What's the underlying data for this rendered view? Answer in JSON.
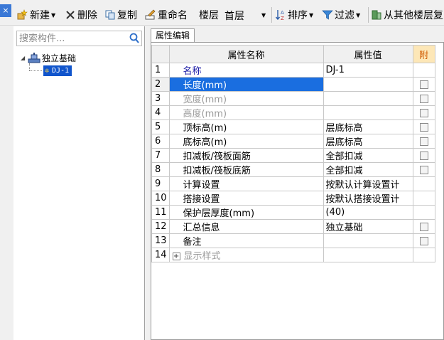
{
  "toolbar": {
    "close_glyph": "×",
    "new_label": "新建",
    "delete_label": "删除",
    "copy_label": "复制",
    "rename_label": "重命名",
    "floor_label": "楼层",
    "floor_value": "首层",
    "sort_label": "排序",
    "filter_label": "过滤",
    "copy_from_floor_label": "从其他楼层复"
  },
  "left_panel": {
    "search_placeholder": "搜索构件...",
    "tree": {
      "root_label": "独立基础",
      "child_label": "DJ-1"
    }
  },
  "main": {
    "tab_label": "属性编辑",
    "headers": {
      "name": "属性名称",
      "value": "属性值",
      "attach": "附"
    },
    "rows": [
      {
        "num": "1",
        "name": "名称",
        "value": "DJ-1",
        "style": "blue",
        "checkbox": false
      },
      {
        "num": "2",
        "name": "长度(mm)",
        "value": "",
        "style": "selected",
        "checkbox": true
      },
      {
        "num": "3",
        "name": "宽度(mm)",
        "value": "",
        "style": "gray",
        "checkbox": true
      },
      {
        "num": "4",
        "name": "高度(mm)",
        "value": "",
        "style": "gray",
        "checkbox": true
      },
      {
        "num": "5",
        "name": "顶标高(m)",
        "value": "层底标高",
        "style": "normal",
        "checkbox": true
      },
      {
        "num": "6",
        "name": "底标高(m)",
        "value": "层底标高",
        "style": "normal",
        "checkbox": true
      },
      {
        "num": "7",
        "name": "扣减板/筏板面筋",
        "value": "全部扣减",
        "style": "normal",
        "checkbox": true
      },
      {
        "num": "8",
        "name": "扣减板/筏板底筋",
        "value": "全部扣减",
        "style": "normal",
        "checkbox": true
      },
      {
        "num": "9",
        "name": "计算设置",
        "value": "按默认计算设置计",
        "style": "normal",
        "checkbox": false
      },
      {
        "num": "10",
        "name": "搭接设置",
        "value": "按默认搭接设置计",
        "style": "normal",
        "checkbox": false
      },
      {
        "num": "11",
        "name": "保护层厚度(mm)",
        "value": "(40)",
        "style": "normal",
        "checkbox": false
      },
      {
        "num": "12",
        "name": "汇总信息",
        "value": "独立基础",
        "style": "normal",
        "checkbox": true
      },
      {
        "num": "13",
        "name": "备注",
        "value": "",
        "style": "normal",
        "checkbox": true
      },
      {
        "num": "14",
        "name": "显示样式",
        "value": "",
        "style": "gray-expand",
        "checkbox": false
      }
    ]
  },
  "colors": {
    "selection_blue": "#1a6ee0",
    "tree_selection": "#1155cc",
    "attach_header_bg": "#fde7b7",
    "name_blue": "#1a1aa6"
  }
}
